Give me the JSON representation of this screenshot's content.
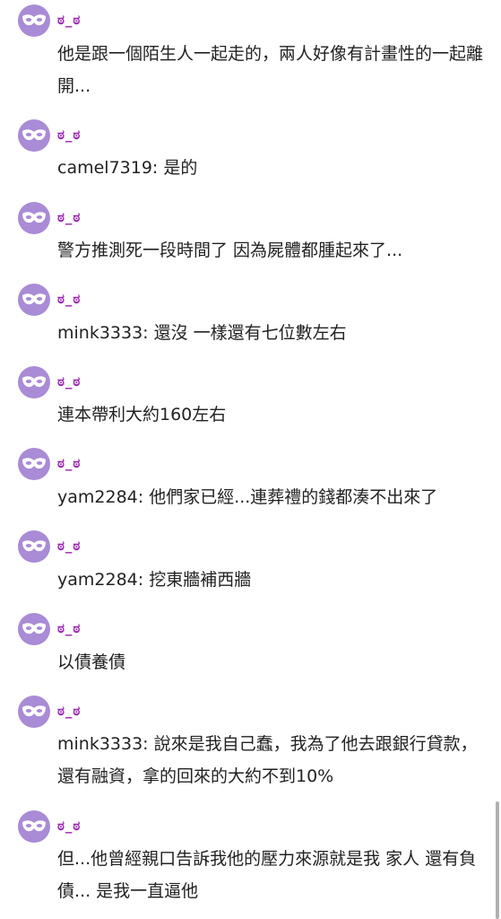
{
  "comments": [
    {
      "username": "ಠ_ಠ",
      "avatar_icon": "mask-icon",
      "text": "他是跟一個陌生人一起走的，兩人好像有計畫性的一起離開..."
    },
    {
      "username": "ಠ_ಠ",
      "avatar_icon": "mask-icon",
      "text": "camel7319: 是的"
    },
    {
      "username": "ಠ_ಠ",
      "avatar_icon": "mask-icon",
      "text": "警方推測死一段時間了 因為屍體都腫起來了..."
    },
    {
      "username": "ಠ_ಠ",
      "avatar_icon": "mask-icon",
      "text": "mink3333: 還沒 一樣還有七位數左右"
    },
    {
      "username": "ಠ_ಠ",
      "avatar_icon": "mask-icon",
      "text": "連本帶利大約160左右"
    },
    {
      "username": "ಠ_ಠ",
      "avatar_icon": "mask-icon",
      "text": "yam2284: 他們家已經...連葬禮的錢都湊不出來了"
    },
    {
      "username": "ಠ_ಠ",
      "avatar_icon": "mask-icon",
      "text": "yam2284: 挖東牆補西牆"
    },
    {
      "username": "ಠ_ಠ",
      "avatar_icon": "mask-icon",
      "text": "以債養債"
    },
    {
      "username": "ಠ_ಠ",
      "avatar_icon": "mask-icon",
      "text": "mink3333: 說來是我自己蠢，我為了他去跟銀行貸款，還有融資，拿的回來的大約不到10%"
    },
    {
      "username": "ಠ_ಠ",
      "avatar_icon": "mask-icon",
      "text": "但...他曾經親口告訴我他的壓力來源就是我 家人 還有負債... 是我一直逼他"
    }
  ],
  "colors": {
    "avatar_bg": "#a98bd6",
    "username": "#9c27b0",
    "text": "#222222"
  }
}
